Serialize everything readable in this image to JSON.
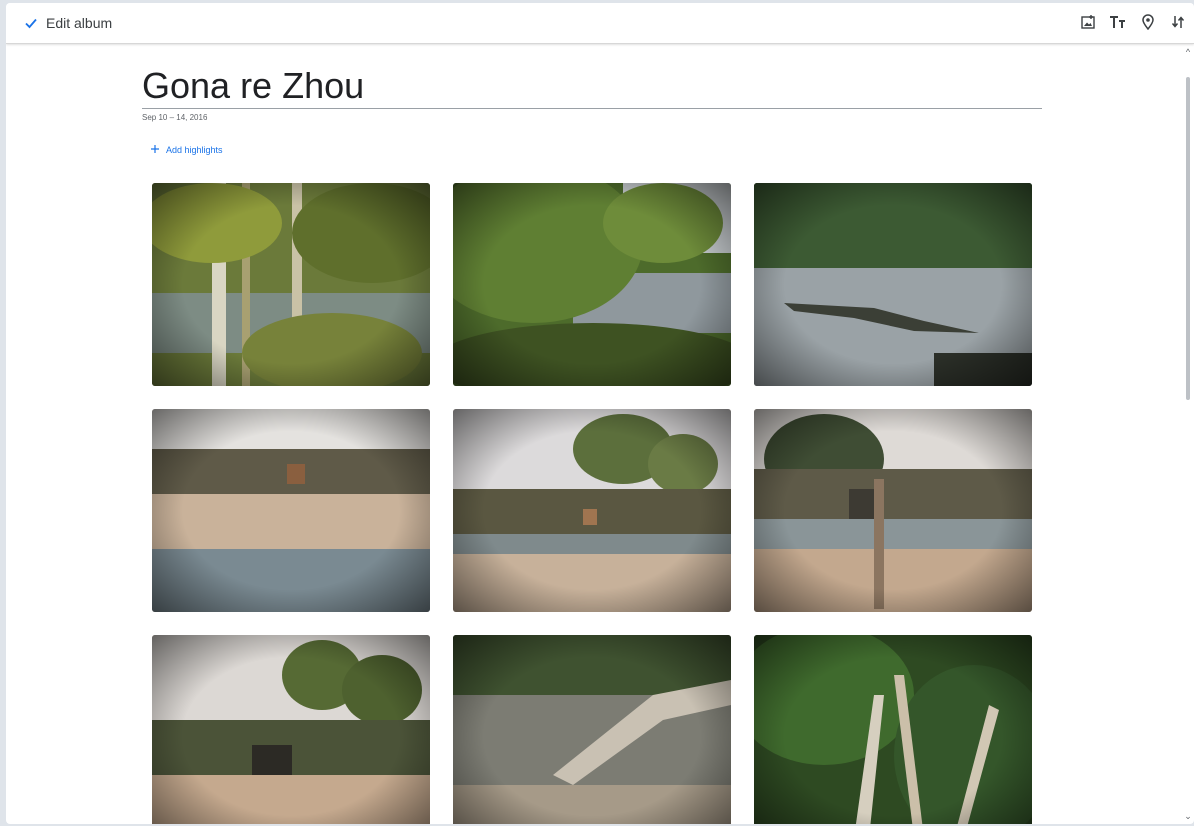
{
  "toolbar": {
    "done_label": "Edit album",
    "tools": [
      "add-photo-icon",
      "text-icon",
      "location-icon",
      "sort-icon"
    ]
  },
  "album": {
    "title": "Gona re Zhou",
    "dates": "Sep 10 – 14, 2016",
    "add_highlights": "Add highlights"
  },
  "photos": [
    {
      "scene": "forest-river"
    },
    {
      "scene": "riverbank-trees"
    },
    {
      "scene": "river-crocodiles"
    },
    {
      "scene": "kudu-in-bush"
    },
    {
      "scene": "antelope-plain"
    },
    {
      "scene": "kudu-bull-scrub"
    },
    {
      "scene": "kudu-under-trees"
    },
    {
      "scene": "fallen-branches"
    },
    {
      "scene": "dense-bush"
    }
  ]
}
